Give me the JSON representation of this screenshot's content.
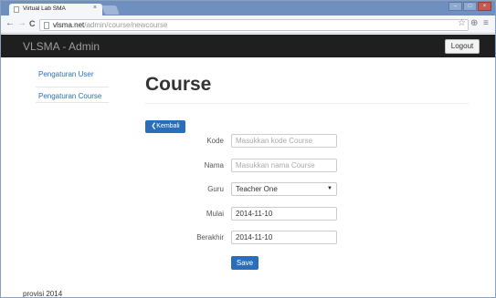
{
  "browser": {
    "tab_title": "Virtual Lab SMA",
    "tab_close": "×",
    "url_host": "vlsma.net",
    "url_path": "/admin/course/newcourse",
    "back": "←",
    "forward": "→",
    "reload": "C",
    "star": "☆",
    "menu": "≡",
    "extension": "⊕",
    "minimize": "–",
    "maximize": "□",
    "close": "×"
  },
  "navbar": {
    "brand": "VLSMA - Admin",
    "logout_label": "Logout"
  },
  "sidebar": {
    "items": [
      {
        "label": "Pengaturan User"
      },
      {
        "label": "Pengaturan Course"
      }
    ]
  },
  "main": {
    "title": "Course",
    "back_label": "❮Kembali",
    "form": {
      "kode": {
        "label": "Kode",
        "placeholder": "Masukkan kode Course"
      },
      "nama": {
        "label": "Nama",
        "placeholder": "Masukkan nama Course"
      },
      "guru": {
        "label": "Guru",
        "value": "Teacher One",
        "caret": "▼"
      },
      "mulai": {
        "label": "Mulai",
        "value": "2014-11-10"
      },
      "berakhir": {
        "label": "Berakhir",
        "value": "2014-11-10"
      }
    },
    "save_label": "Save"
  },
  "footer": {
    "text": "provisi 2014"
  }
}
